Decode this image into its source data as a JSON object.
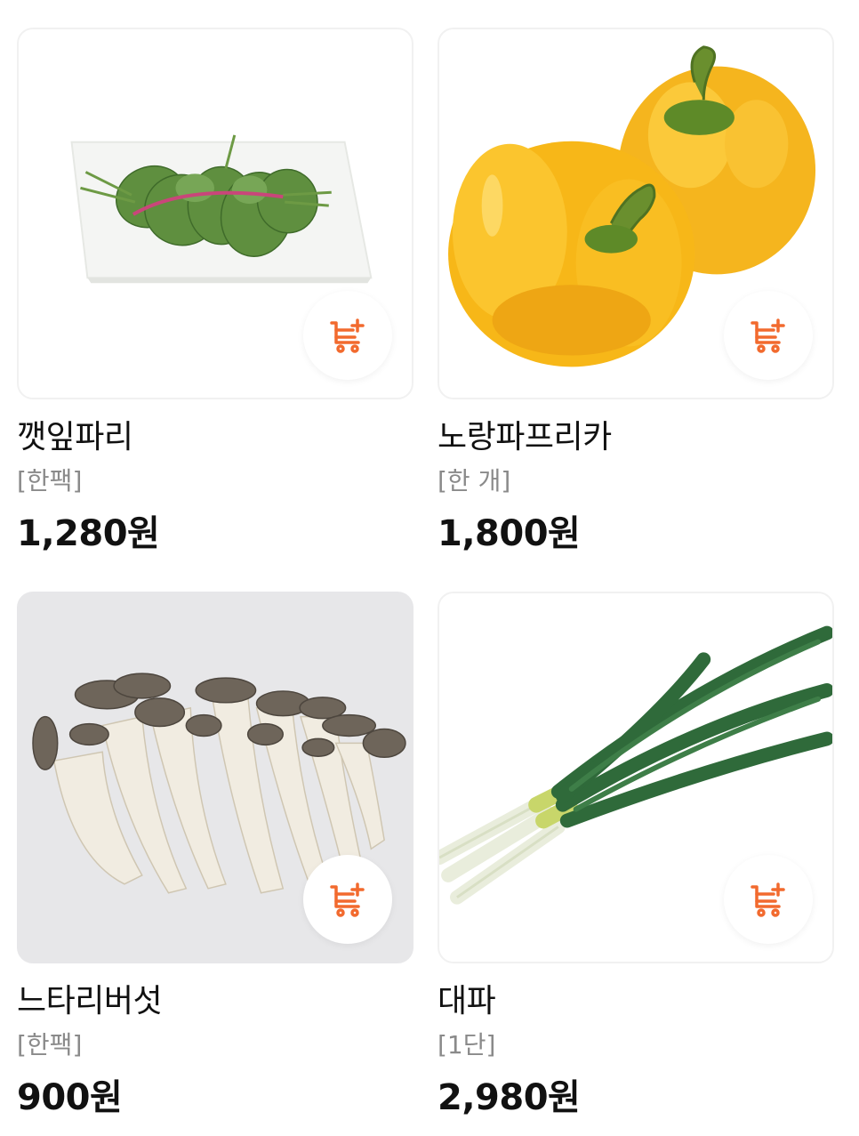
{
  "colors": {
    "accent": "#F26A2E",
    "text": "#111111",
    "subtext": "#8A8A8A"
  },
  "products": [
    {
      "name": "깻잎파리",
      "unit": "[한팩]",
      "price": "1,280원",
      "image": "perilla-leaves",
      "cart_icon": "add-to-cart-icon"
    },
    {
      "name": "노랑파프리카",
      "unit": "[한 개]",
      "price": "1,800원",
      "image": "yellow-paprika",
      "cart_icon": "add-to-cart-icon"
    },
    {
      "name": "느타리버섯",
      "unit": "[한팩]",
      "price": "900원",
      "image": "oyster-mushrooms",
      "cart_icon": "add-to-cart-icon"
    },
    {
      "name": "대파",
      "unit": "[1단]",
      "price": "2,980원",
      "image": "green-onion",
      "cart_icon": "add-to-cart-icon"
    }
  ]
}
